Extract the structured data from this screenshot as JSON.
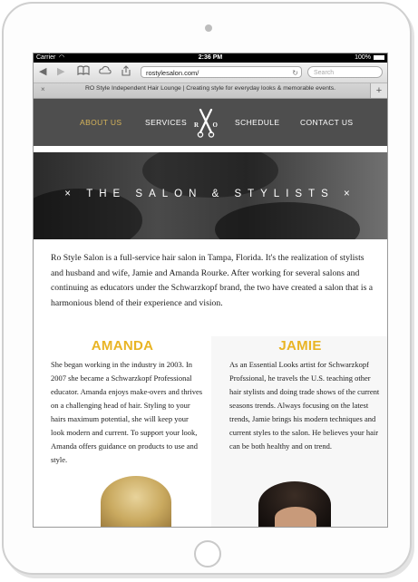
{
  "status_bar": {
    "carrier": "Carrier",
    "time": "2:36 PM",
    "battery": "100%"
  },
  "browser": {
    "url": "rostylesalon.com/",
    "search_placeholder": "Search",
    "tab_title": "RO Style Independent Hair Lounge | Creating style for everyday looks & memorable events.",
    "new_tab": "+",
    "close_tab": "×"
  },
  "nav": {
    "items": [
      "ABOUT US",
      "SERVICES",
      "SCHEDULE",
      "CONTACT US"
    ],
    "logo_left": "R",
    "logo_right": "O",
    "active_color": "#d6b45a"
  },
  "hero": {
    "title": "THE SALON & STYLISTS"
  },
  "intro": "Ro Style Salon is a full-service hair salon in Tampa, Florida. It's the realization of stylists and husband and wife, Jamie and Amanda Rourke. After working for several salons and continuing as educators under the Schwarzkopf brand, the two have created a salon that is a harmonious blend of their experience and vision.",
  "stylists": [
    {
      "name": "AMANDA",
      "bio": "She began working in the industry in 2003. In 2007 she became a Schwarzkopf Professional educator. Amanda enjoys make-overs and thrives on a challenging head of hair. Styling to your hairs maximum potential, she will keep your look modern and current. To support your look, Amanda offers guidance on products to use and style."
    },
    {
      "name": "JAMIE",
      "bio": "As an Essential Looks artist for Schwarzkopf Profssional, he travels the U.S. teaching other hair stylists and doing trade shows of the current seasons trends. Always focusing on the latest trends, Jamie brings his modern techniques and current styles to the salon. He believes your hair can be both healthy and on trend."
    }
  ],
  "accent_color": "#e9b424"
}
